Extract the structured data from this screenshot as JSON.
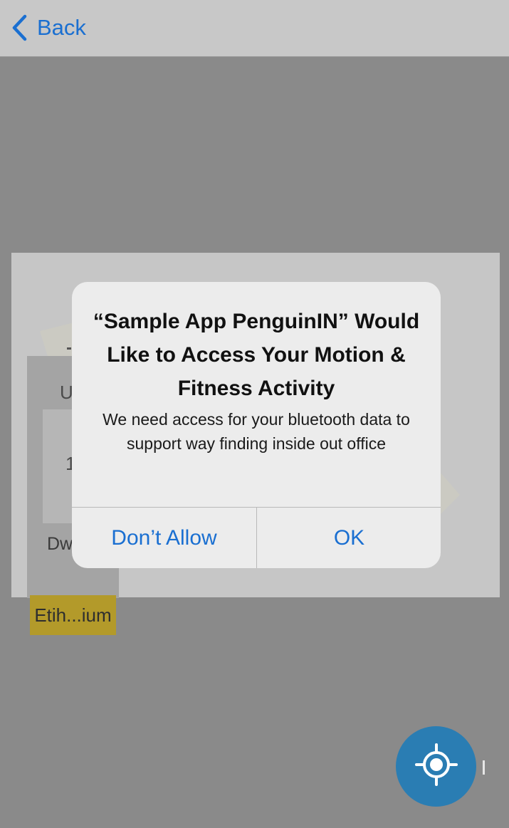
{
  "navbar": {
    "back_label": "Back",
    "back_icon": "chevron-left-icon"
  },
  "map": {
    "room_partial_letter": "U",
    "room_partial_digit": "1",
    "room_partial_label": "Dw",
    "poi_label": "Etih...ium"
  },
  "alert": {
    "title": "“Sample App PenguinIN” Would Like to Access Your Motion & Fitness Activity",
    "message": "We need access for your bluetooth data to support way finding inside out office",
    "deny_label": "Don’t Allow",
    "ok_label": "OK"
  },
  "controls": {
    "locate_icon": "crosshair-icon"
  },
  "colors": {
    "accent": "#1a6fd1",
    "locate_button": "#2a7db3",
    "poi_highlight": "#b39a2a"
  }
}
